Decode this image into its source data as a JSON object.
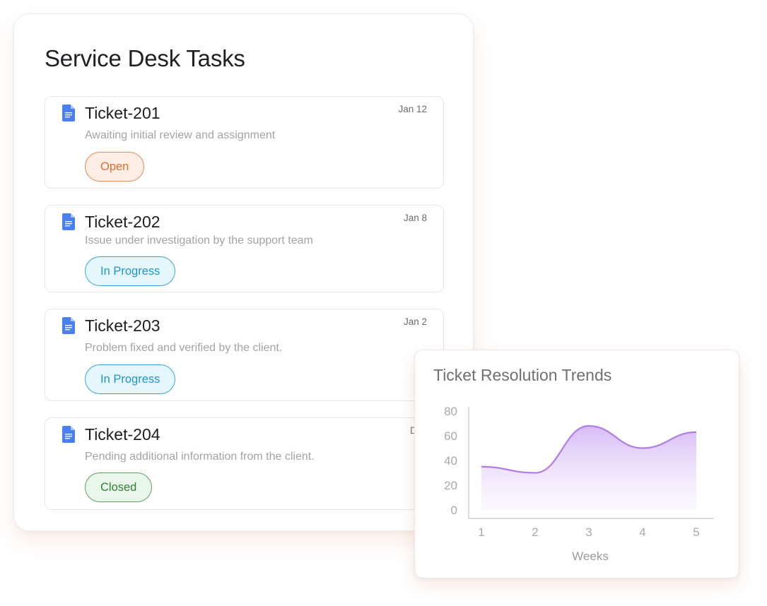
{
  "panel": {
    "title": "Service Desk Tasks"
  },
  "tickets": [
    {
      "name": "Ticket-201",
      "date": "Jan 12",
      "description": "Awaiting initial review and assignment",
      "status": "Open",
      "status_kind": "open",
      "icon": "google-docs-icon"
    },
    {
      "name": "Ticket-202",
      "date": "Jan 8",
      "description": "Issue under investigation by the support team",
      "status": "In Progress",
      "status_kind": "progress",
      "icon": "google-docs-icon"
    },
    {
      "name": "Ticket-203",
      "date": "Jan 2",
      "description": "Problem fixed and verified by the client.",
      "status": "In Progress",
      "status_kind": "progress",
      "icon": "google-docs-icon"
    },
    {
      "name": "Ticket-204",
      "date": "Dec",
      "description": "Pending additional information from the client.",
      "status": "Closed",
      "status_kind": "closed",
      "icon": "google-docs-icon"
    }
  ],
  "colors": {
    "doc_icon": "#4a7ff0",
    "status_open": "#dd6d33",
    "status_progress": "#1f95cf",
    "status_closed": "#2f7f35",
    "chart_line": "#b07ee6",
    "chart_fill": "#d9c2f7"
  },
  "chart_data": {
    "type": "area",
    "title": "Ticket Resolution Trends",
    "xlabel": "Weeks",
    "ylabel": "",
    "x": [
      1,
      2,
      3,
      4,
      5
    ],
    "y_ticks": [
      0,
      20,
      40,
      60,
      80
    ],
    "ylim": [
      0,
      80
    ],
    "series": [
      {
        "values": [
          35,
          30,
          68,
          50,
          63
        ]
      }
    ],
    "grid": false,
    "legend": "none"
  }
}
